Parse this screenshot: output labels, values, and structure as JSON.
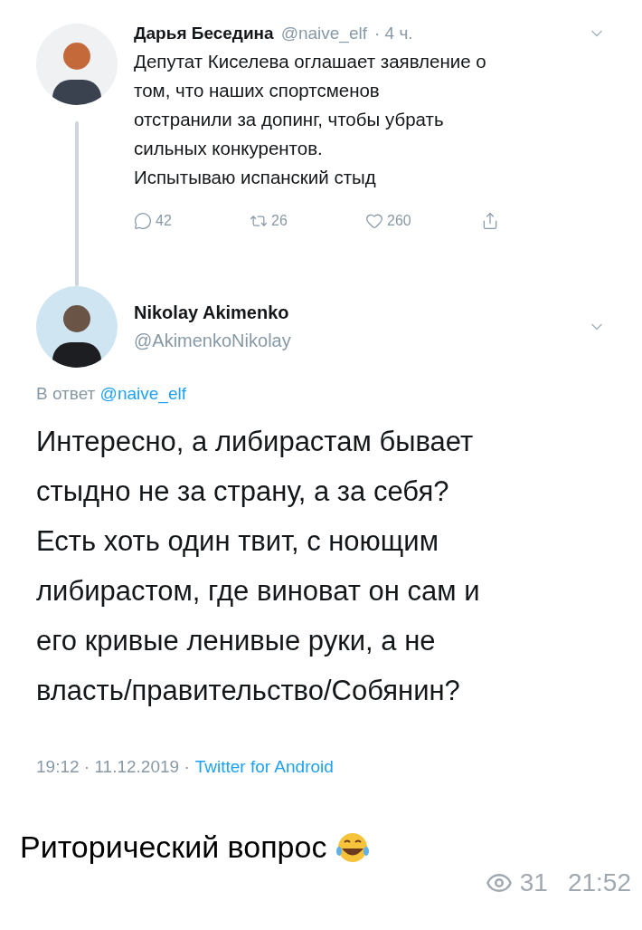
{
  "quoted_tweet": {
    "name": "Дарья Беседина",
    "handle": "@naive_elf",
    "time": "· 4 ч.",
    "text": "Депутат Киселева оглашает заявление о\nтом, что наших спортсменов\nотстранили за допинг, чтобы убрать\nсильных конкурентов.\nИспытываю испанский стыд",
    "actions": [
      {
        "kind": "reply",
        "count": "42"
      },
      {
        "kind": "retweet",
        "count": "26"
      },
      {
        "kind": "like",
        "count": "260"
      },
      {
        "kind": "share"
      }
    ]
  },
  "tweet": {
    "name": "Nikolay Akimenko",
    "handle": "@AkimenkoNikolay",
    "reply_prefix": "В ответ",
    "reply_to": "@naive_elf",
    "text": "Интересно, а либирастам бывает\nстыдно не за страну, а за себя?\nЕсть хоть один твит, с ноющим\nлибирастом, где виноват он сам и\nего кривые ленивые руки, а не\nвласть/правительство/Собянин?",
    "timestamp": "19:12 · 11.12.2019 ·",
    "source": "Twitter for Android"
  },
  "message": {
    "caption": "Риторический вопрос",
    "views": "31",
    "time": "21:52"
  }
}
